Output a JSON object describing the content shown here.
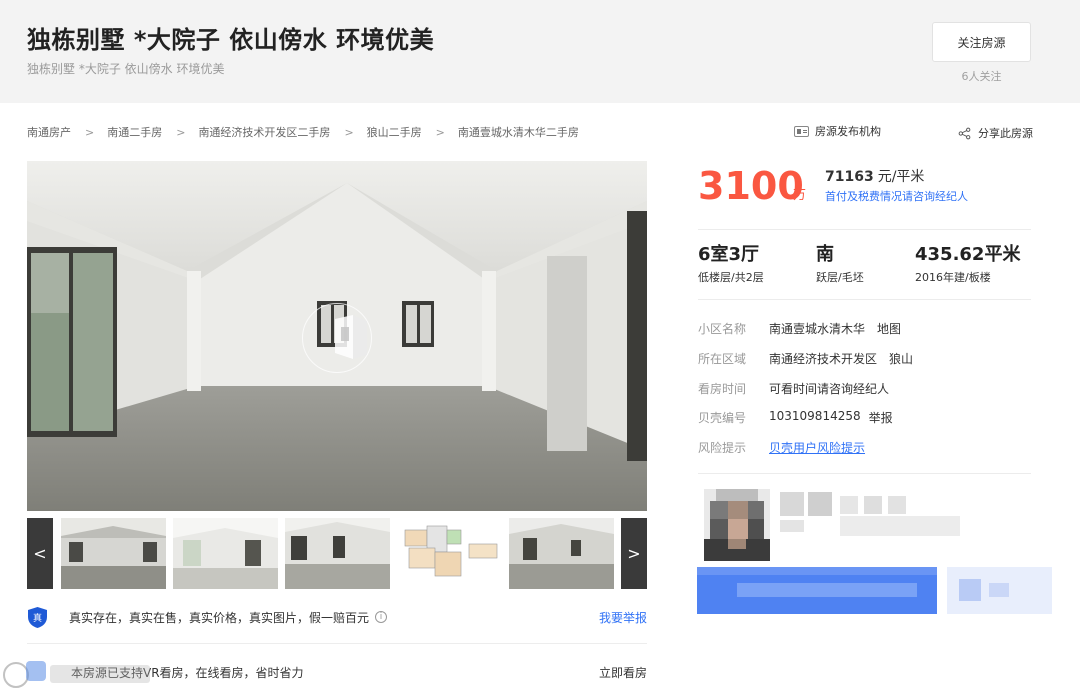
{
  "header": {
    "title": "独栋别墅 *大院子 依山傍水 环境优美",
    "subtitle": "独栋别墅 *大院子 依山傍水 环境优美",
    "follow_button": "关注房源",
    "follow_count": "6人关注"
  },
  "breadcrumb": [
    "南通房产",
    "南通二手房",
    "南通经济技术开发区二手房",
    "狼山二手房",
    "南通壹城水清木华二手房"
  ],
  "toolbar": {
    "agency_label": "房源发布机构",
    "share_label": "分享此房源"
  },
  "gallery": {
    "prev": "<",
    "next": ">",
    "thumbnails": [
      "living-room",
      "bright-room",
      "room-windows",
      "floor-plan",
      "empty-room"
    ]
  },
  "price": {
    "total": "3100",
    "total_unit": "万",
    "unit_price_value": "71163",
    "unit_price_suffix": "元/平米",
    "tax_note": "首付及税费情况请咨询经纪人",
    "accent_color": "#fa5741"
  },
  "specs": [
    {
      "main": "6室3厅",
      "sub": "低楼层/共2层"
    },
    {
      "main": "南",
      "sub": "跃层/毛坯"
    },
    {
      "main": "435.62平米",
      "sub": "2016年建/板楼"
    }
  ],
  "details": {
    "community": {
      "label": "小区名称",
      "value": "南通壹城水清木华",
      "extra": "地图"
    },
    "area": {
      "label": "所在区域",
      "value": "南通经济技术开发区",
      "extra": "狼山"
    },
    "visit": {
      "label": "看房时间",
      "value": "可看时间请咨询经纪人"
    },
    "code": {
      "label": "贝壳编号",
      "value": "103109814258",
      "extra": "举报"
    },
    "risk": {
      "label": "风险提示",
      "value": "贝壳用户风险提示"
    }
  },
  "guarantee": {
    "badge": "真",
    "text": "真实存在，真实在售，真实价格，真实图片，假一赔百元",
    "info_icon": "i",
    "report_link": "我要举报"
  },
  "vr": {
    "text": "本房源已支持VR看房，在线看房，省时省力",
    "link": "立即看房"
  },
  "colors": {
    "link": "#3072f6",
    "header_bg": "#f3f3f3"
  }
}
